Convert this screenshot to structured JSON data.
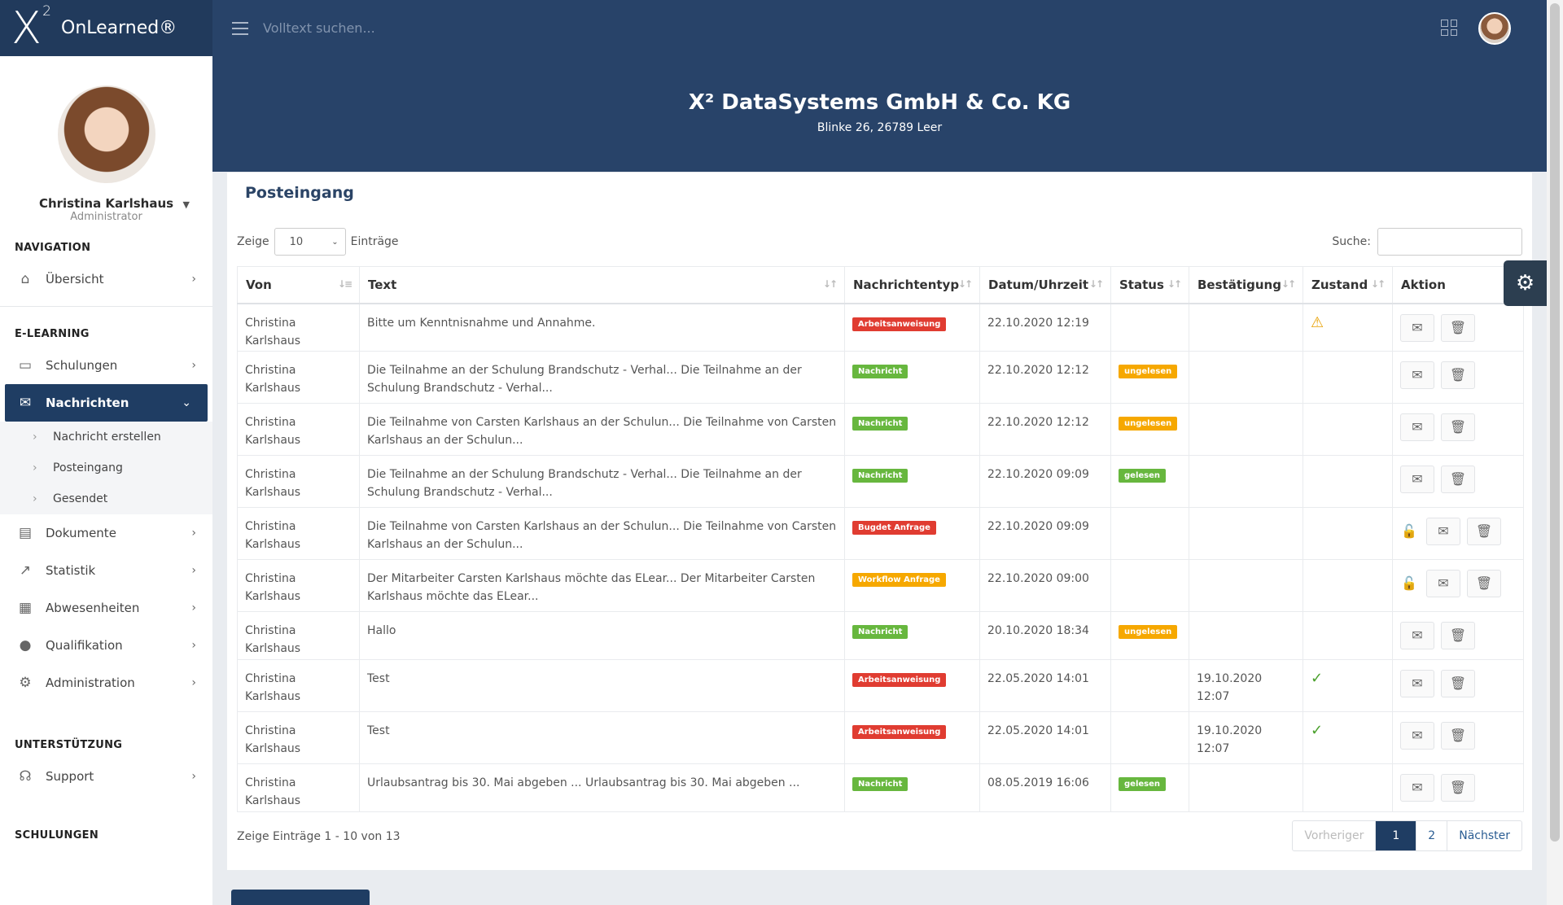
{
  "app": {
    "brand": "OnLearned®",
    "logo_letter": "X",
    "logo_sup": "2"
  },
  "topbar": {
    "search_placeholder": "Volltext suchen..."
  },
  "user": {
    "name": "Christina Karlshaus",
    "role": "Administrator"
  },
  "company": {
    "name": "X² DataSystems GmbH & Co. KG",
    "address": "Blinke 26, 26789 Leer"
  },
  "sidebar": {
    "navigation_title": "NAVIGATION",
    "overview": "Übersicht",
    "elearning_title": "E-LEARNING",
    "trainings": "Schulungen",
    "messages": "Nachrichten",
    "sub_create": "Nachricht erstellen",
    "sub_inbox": "Posteingang",
    "sub_sent": "Gesendet",
    "documents": "Dokumente",
    "statistics": "Statistik",
    "absences": "Abwesenheiten",
    "qualification": "Qualifikation",
    "administration": "Administration",
    "support_title": "UNTERSTÜTZUNG",
    "support": "Support",
    "trainings_title": "SCHULUNGEN"
  },
  "panel": {
    "title": "Posteingang",
    "show_label": "Zeige",
    "show_value": "10",
    "entries_label": "Einträge",
    "search_label": "Suche:",
    "info": "Zeige Einträge 1 - 10 von 13"
  },
  "table": {
    "headers": [
      "Von",
      "Text",
      "Nachrichtentyp",
      "Datum/Uhrzeit",
      "Status",
      "Bestätigung",
      "Zustand",
      "Aktion"
    ],
    "rows": [
      {
        "from": "Christina Karlshaus",
        "text": "Bitte um Kenntnisnahme und Annahme.",
        "type": "Arbeitsanweisung",
        "date": "22.10.2020 12:19",
        "status": "",
        "confirm": ""
      },
      {
        "from": "Christina Karlshaus",
        "text": "Die Teilnahme an der Schulung Brandschutz - Verhal... Die Teilnahme an der Schulung Brandschutz - Verhal...",
        "type": "Nachricht",
        "date": "22.10.2020 12:12",
        "status": "ungelesen",
        "confirm": ""
      },
      {
        "from": "Christina Karlshaus",
        "text": "Die Teilnahme von Carsten Karlshaus an der Schulun... Die Teilnahme von Carsten Karlshaus an der Schulun...",
        "type": "Nachricht",
        "date": "22.10.2020 12:12",
        "status": "ungelesen",
        "confirm": ""
      },
      {
        "from": "Christina Karlshaus",
        "text": "Die Teilnahme an der Schulung Brandschutz - Verhal... Die Teilnahme an der Schulung Brandschutz - Verhal...",
        "type": "Nachricht",
        "date": "22.10.2020 09:09",
        "status": "gelesen",
        "confirm": ""
      },
      {
        "from": "Christina Karlshaus",
        "text": "Die Teilnahme von Carsten Karlshaus an der Schulun... Die Teilnahme von Carsten Karlshaus an der Schulun...",
        "type": "Bugdet Anfrage",
        "date": "22.10.2020 09:09",
        "status": "",
        "confirm": ""
      },
      {
        "from": "Christina Karlshaus",
        "text": "Der Mitarbeiter Carsten Karlshaus möchte das ELear... Der Mitarbeiter Carsten Karlshaus möchte das ELear...",
        "type": "Workflow Anfrage",
        "date": "22.10.2020 09:00",
        "status": "",
        "confirm": ""
      },
      {
        "from": "Christina Karlshaus",
        "text": "Hallo",
        "type": "Nachricht",
        "date": "20.10.2020 18:34",
        "status": "ungelesen",
        "confirm": ""
      },
      {
        "from": "Christina Karlshaus",
        "text": "Test",
        "type": "Arbeitsanweisung",
        "date": "22.05.2020 14:01",
        "status": "",
        "confirm": "19.10.2020 12:07"
      },
      {
        "from": "Christina Karlshaus",
        "text": "Test",
        "type": "Arbeitsanweisung",
        "date": "22.05.2020 14:01",
        "status": "",
        "confirm": "19.10.2020 12:07"
      },
      {
        "from": "Christina Karlshaus",
        "text": "Urlaubsantrag bis 30. Mai abgeben ... Urlaubsantrag bis 30. Mai abgeben ...",
        "type": "Nachricht",
        "date": "08.05.2019 16:06",
        "status": "gelesen",
        "confirm": ""
      }
    ]
  },
  "pager": {
    "prev": "Vorheriger",
    "page1": "1",
    "page2": "2",
    "next": "Nächster"
  },
  "colors": {
    "navy": "#284369",
    "red": "#e03c31",
    "green": "#67b73e",
    "orange": "#f6a800"
  }
}
